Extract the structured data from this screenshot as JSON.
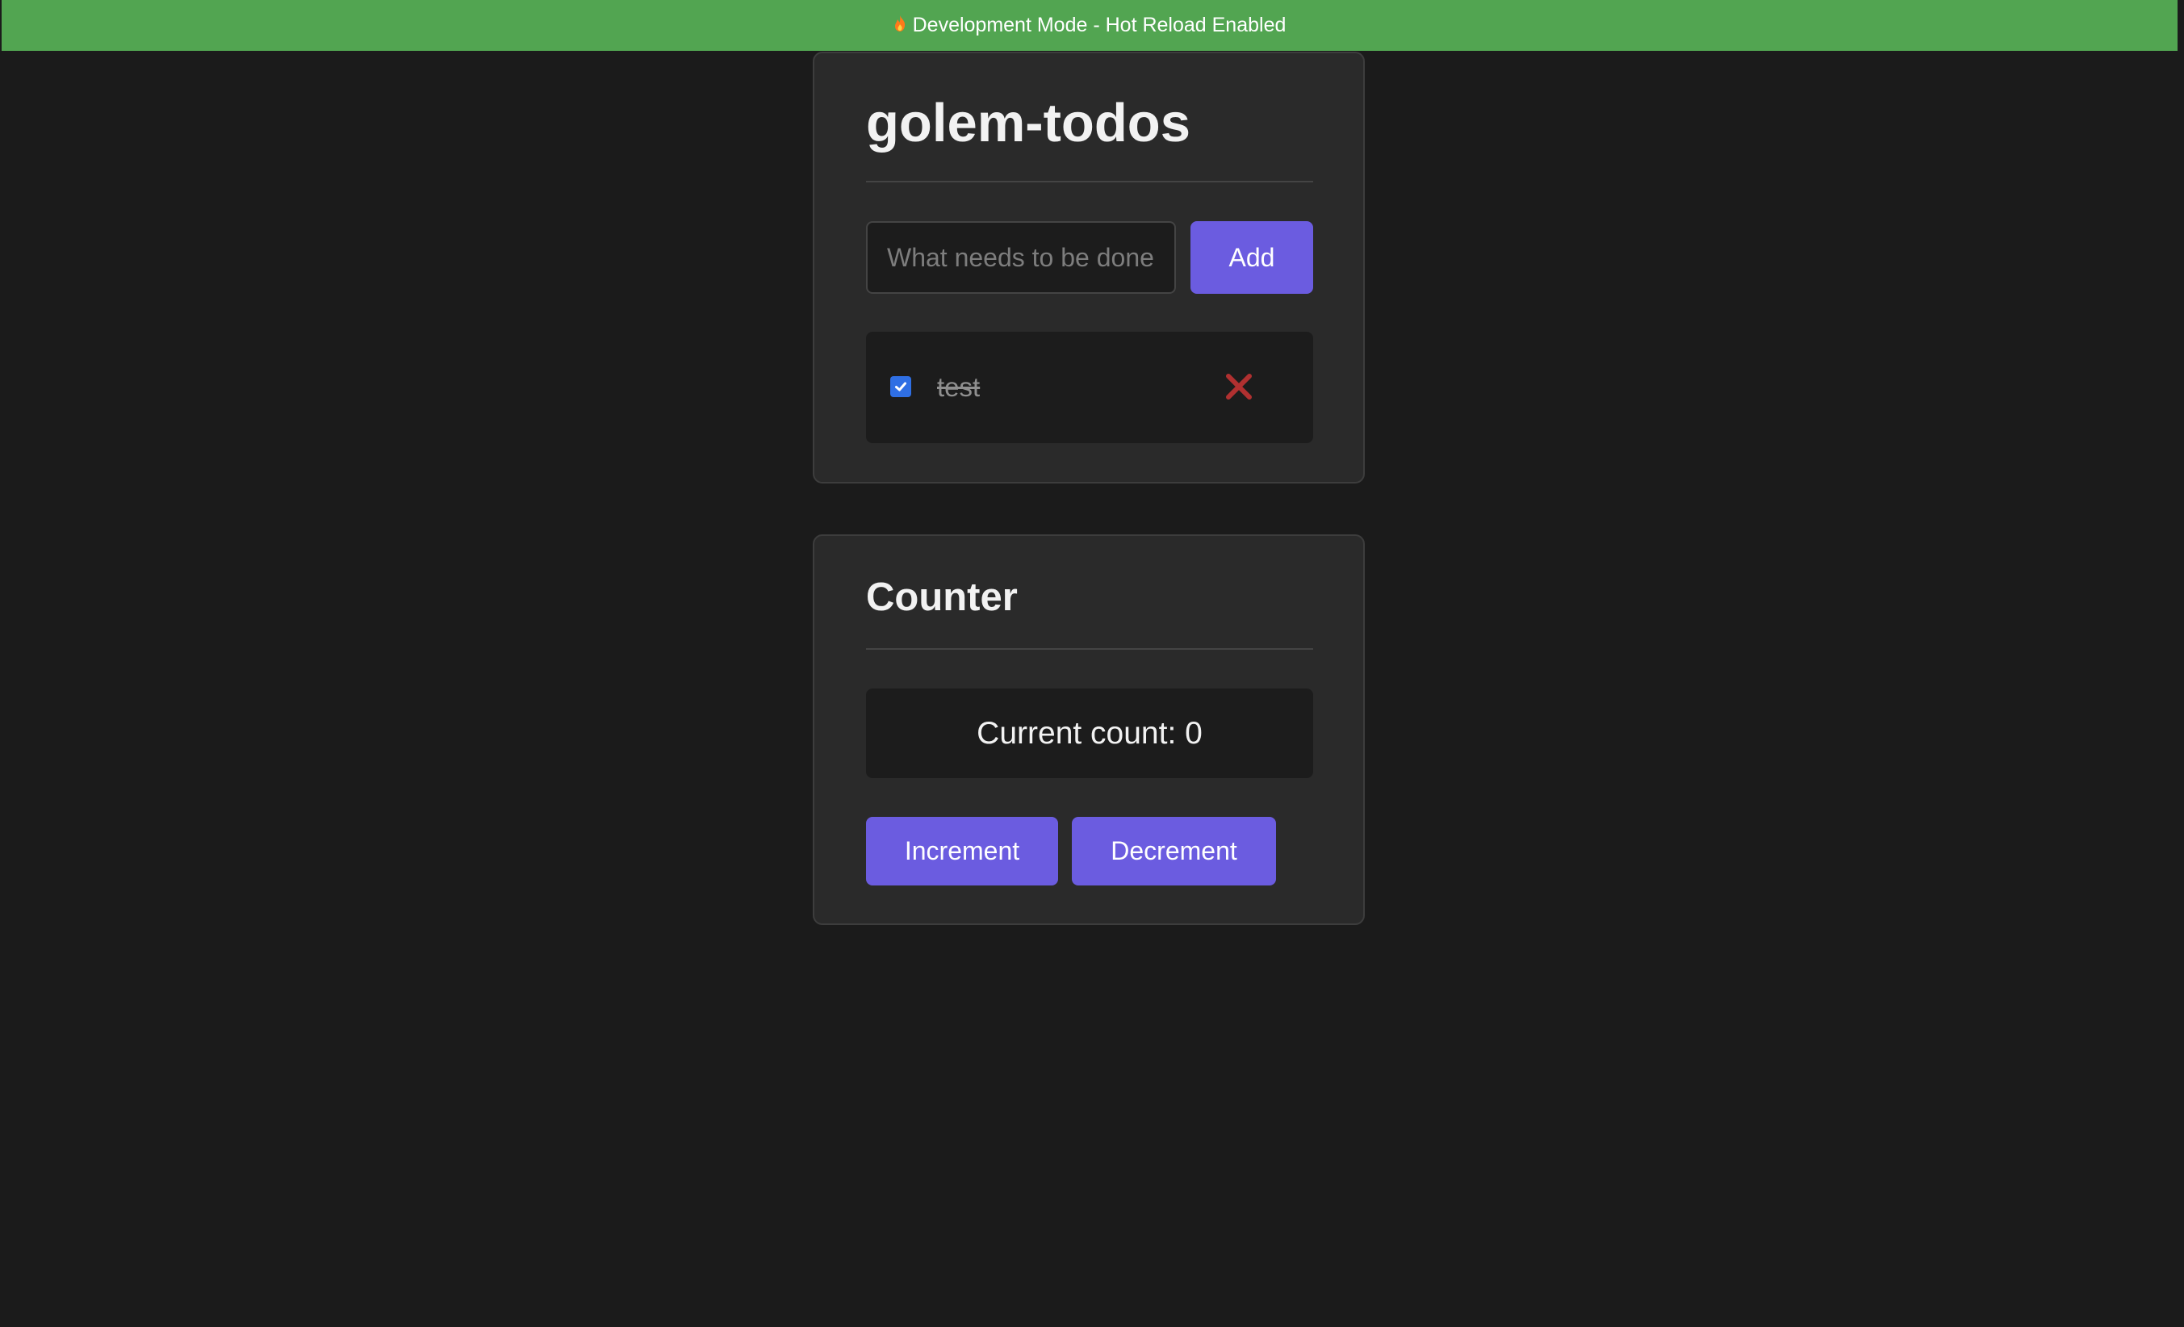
{
  "banner": {
    "icon": "flame-icon",
    "text": "Development Mode - Hot Reload Enabled",
    "color": "#52a551"
  },
  "todos": {
    "title": "golem-todos",
    "input_placeholder": "What needs to be done?",
    "input_value": "",
    "add_label": "Add",
    "items": [
      {
        "text": "test",
        "completed": true,
        "delete_icon": "close-icon"
      }
    ]
  },
  "counter": {
    "title": "Counter",
    "count_text": "Current count: 0",
    "increment_label": "Increment",
    "decrement_label": "Decrement"
  },
  "colors": {
    "background": "#1b1b1b",
    "card": "#2a2a2a",
    "accent": "#6b5ce0",
    "delete": "#b03030",
    "checkbox": "#2f6fe4"
  }
}
